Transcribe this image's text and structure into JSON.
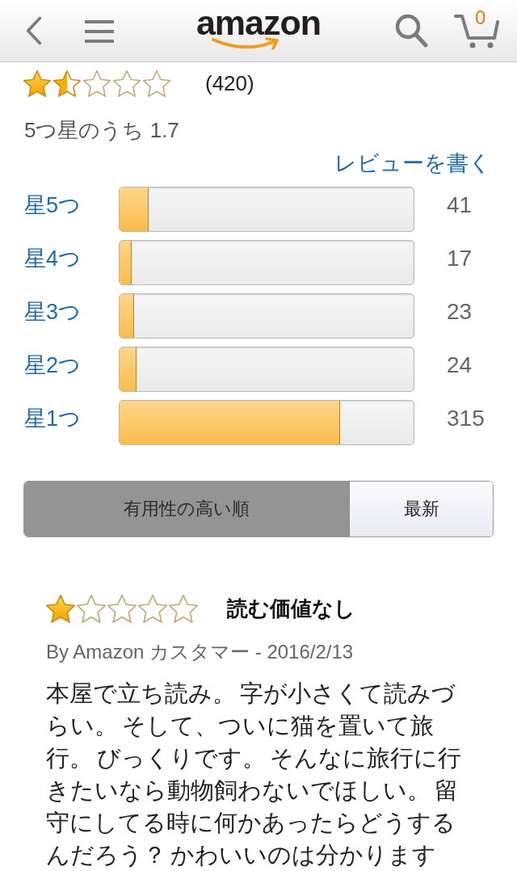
{
  "header": {
    "logo": "amazon",
    "cart_count": "0"
  },
  "rating": {
    "stars": 1.5,
    "count": "(420)",
    "summary": "5つ星のうち 1.7"
  },
  "write_review_link": "レビューを書く",
  "histogram": [
    {
      "label": "星5つ",
      "level": 0.098,
      "count": "41"
    },
    {
      "label": "星4つ",
      "level": 0.04,
      "count": "17"
    },
    {
      "label": "星3つ",
      "level": 0.05,
      "count": "23"
    },
    {
      "label": "星2つ",
      "level": 0.057,
      "count": "24"
    },
    {
      "label": "星1つ",
      "level": 0.75,
      "count": "315"
    }
  ],
  "sort_tabs": [
    {
      "label": "有用性の高い順",
      "selected": true
    },
    {
      "label": "最新",
      "selected": false
    }
  ],
  "reviews": [
    {
      "stars": 1,
      "title": "読む価値なし",
      "byline": "By Amazon カスタマー - 2016/2/13",
      "body": "本屋で立ち読み。 字が小さくて読みづらい。 そして、ついに猫を置いて旅行。 びっくりです。 そんなに旅行に行きたいなら動物飼わないでほしい。 留守にしてる時に何かあったらどうするんだろう？ かわいいのは分かります"
    }
  ]
}
